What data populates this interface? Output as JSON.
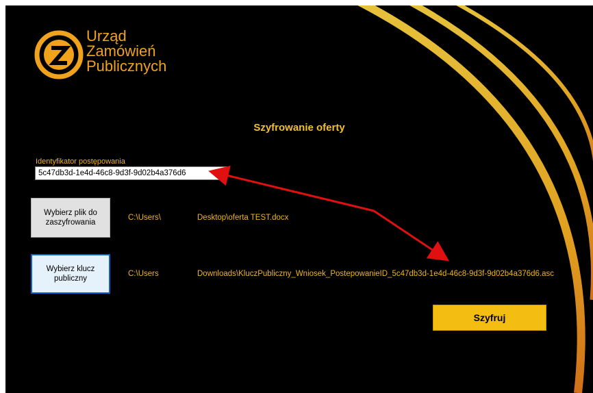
{
  "app": {
    "logo_lines": [
      "Urząd",
      "Zamówień",
      "Publicznych"
    ],
    "logo_icon": "z-circle-icon",
    "title": "Szyfrowanie oferty"
  },
  "form": {
    "id_label": "Identyfikator postępowania",
    "id_value": "5c47db3d-1e4d-46c8-9d3f-9d02b4a376d6",
    "choose_file_label": "Wybierz plik do zaszyfrowania",
    "file_path_prefix": "C:\\Users\\",
    "file_path_suffix": "Desktop\\oferta TEST.docx",
    "choose_key_label": "Wybierz klucz publiczny",
    "key_path_prefix": "C:\\Users",
    "key_path_suffix": "Downloads\\KluczPubliczny_Wniosek_PostepowanieID_5c47db3d-1e4d-46c8-9d3f-9d02b4a376d6.asc",
    "encrypt_label": "Szyfruj"
  },
  "colors": {
    "accent": "#f3bd12",
    "text_orange": "#f0b41c",
    "background": "#000000",
    "annotation_arrow": "#e01010"
  }
}
